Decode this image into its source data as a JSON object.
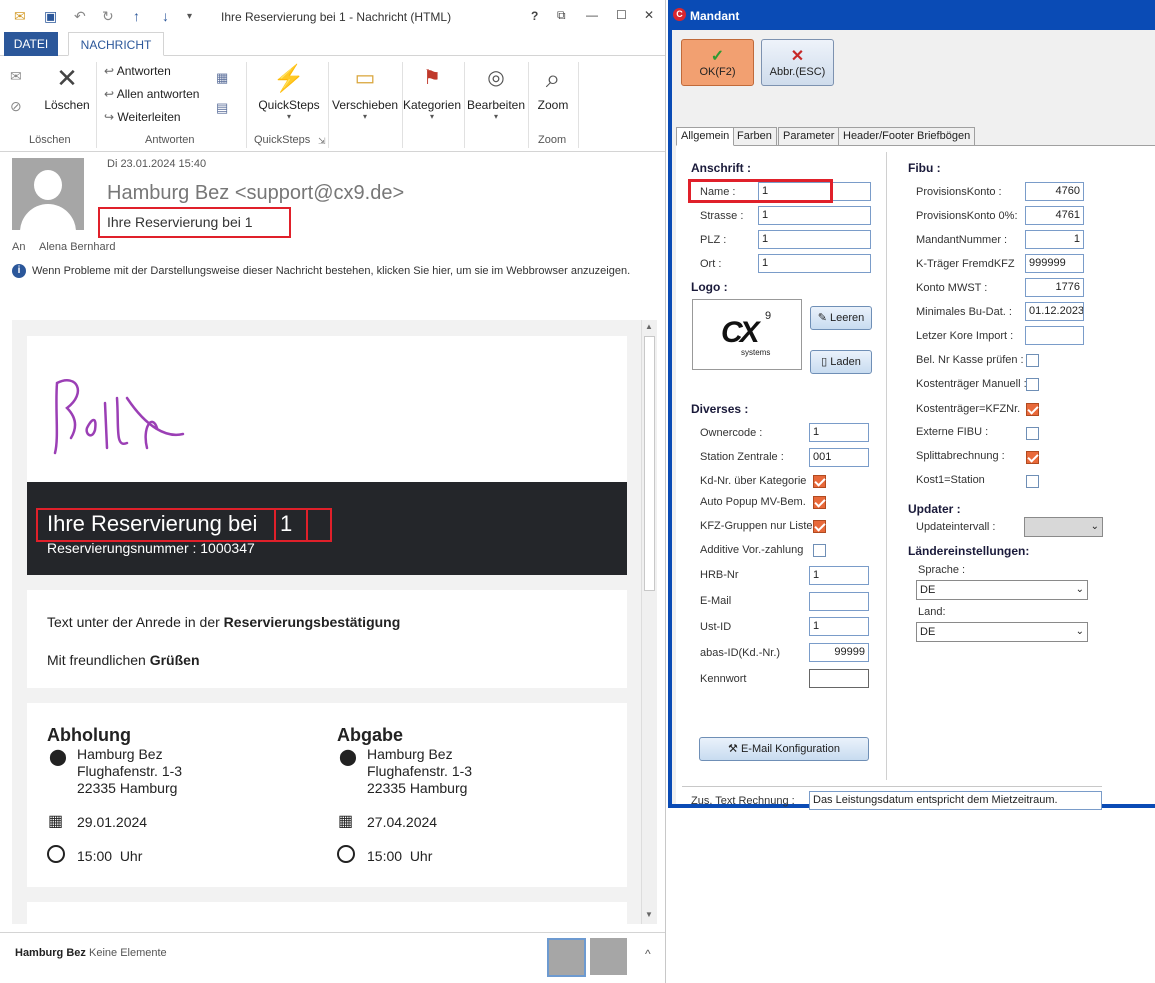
{
  "outlook": {
    "window_title": "Ihre Reservierung bei 1 - Nachricht (HTML)",
    "title_controls": {
      "help": "?",
      "restore": "⧉",
      "minimize": "—",
      "maximize": "☐",
      "close": "✕"
    },
    "tabs": [
      "DATEI",
      "NACHRICHT"
    ],
    "ribbon": {
      "loeschen_group": "Löschen",
      "loeschen_btn": "Löschen",
      "antworten_group": "Antworten",
      "antworten": "Antworten",
      "allen_antworten": "Allen antworten",
      "weiterleiten": "Weiterleiten",
      "quicksteps_group": "QuickSteps",
      "quicksteps_btn": "QuickSteps",
      "verschieben": "Verschieben",
      "kategorien": "Kategorien",
      "bearbeiten": "Bearbeiten",
      "zoom_group": "Zoom",
      "zoom_btn": "Zoom"
    },
    "header": {
      "date": "Di 23.01.2024 15:40",
      "from": "Hamburg Bez <support@cx9.de>",
      "subject": "Ihre Reservierung bei 1",
      "to_label": "An",
      "to": "Alena Bernhard",
      "info": "Wenn Probleme mit der Darstellungsweise dieser Nachricht bestehen, klicken Sie hier, um sie im Webbrowser anzuzeigen."
    },
    "body": {
      "headline_prefix": "Ihre Reservierung bei",
      "headline_value": "1",
      "resnum": "Reservierungsnummer : 1000347",
      "text_prefix": "Text unter der Anrede in der",
      "text_bold": "Reservierungsbestätigung",
      "greeting_prefix": "Mit freundlichen",
      "greeting_bold": "Grüßen",
      "pickup": {
        "title": "Abholung",
        "name": "Hamburg Bez",
        "street": "Flughafenstr. 1-3",
        "city": "22335 Hamburg",
        "date": "29.01.2024",
        "time": "15:00  Uhr"
      },
      "dropoff": {
        "title": "Abgabe",
        "name": "Hamburg Bez",
        "street": "Flughafenstr. 1-3",
        "city": "22335 Hamburg",
        "date": "27.04.2024",
        "time": "15:00  Uhr"
      }
    },
    "footer": {
      "sender": "Hamburg Bez",
      "status": "Keine Elemente"
    }
  },
  "mandant": {
    "title": "Mandant",
    "ok": "OK(F2)",
    "cancel": "Abbr.(ESC)",
    "tabs": [
      "Allgemein",
      "Farben",
      "Parameter",
      "Header/Footer Briefbögen"
    ],
    "anschrift": {
      "section": "Anschrift :",
      "name_label": "Name :",
      "name": "1",
      "strasse_label": "Strasse :",
      "strasse": "1",
      "plz_label": "PLZ :",
      "plz": "1",
      "ort_label": "Ort :",
      "ort": "1"
    },
    "logo": {
      "section": "Logo :",
      "leeren": "Leeren",
      "laden": "Laden",
      "logo_text": "systems",
      "logo_sup": "9"
    },
    "diverses": {
      "section": "Diverses :",
      "ownercode_label": "Ownercode :",
      "ownercode": "1",
      "station_label": "Station Zentrale :",
      "station": "001",
      "kdnr_label": "Kd-Nr. über Kategorie",
      "popup_label": "Auto Popup MV-Bem.",
      "kfz_label": "KFZ-Gruppen nur Liste",
      "additive_label": "Additive Vor.-zahlung",
      "hrb_label": "HRB-Nr",
      "hrb": "1",
      "email_label": "E-Mail",
      "email": "",
      "ustid_label": "Ust-ID",
      "ustid": "1",
      "abas_label": "abas-ID(Kd.-Nr.)",
      "abas": "99999",
      "kennwort_label": "Kennwort",
      "kennwort": "",
      "email_config": "E-Mail Konfiguration"
    },
    "fibu": {
      "section": "Fibu :",
      "provision_label": "ProvisionsKonto :",
      "provision": "4760",
      "provision0_label": "ProvisionsKonto 0%:",
      "provision0": "4761",
      "mandnr_label": "MandantNummer :",
      "mandnr": "1",
      "ktraeger_label": "K-Träger FremdKFZ",
      "ktraeger": "999999",
      "mwst_label": "Konto MWST :",
      "mwst": "1776",
      "budat_label": "Minimales Bu-Dat. :",
      "budat": "01.12.2023",
      "kore_label": "Letzer Kore Import :",
      "kore": "",
      "belnr_label": "Bel. Nr Kasse prüfen :",
      "ktman_label": "Kostenträger Manuell :",
      "ktkfz_label": "Kostenträger=KFZNr.",
      "extfibu_label": "Externe FIBU :",
      "split_label": "Splittabrechnung :",
      "kost1_label": "Kost1=Station"
    },
    "updater": {
      "section": "Updater :",
      "interval_label": "Updateintervall :",
      "interval": ""
    },
    "laender": {
      "section": "Ländereinstellungen:",
      "sprache_label": "Sprache :",
      "sprache": "DE",
      "land_label": "Land:",
      "land": "DE"
    },
    "zus_label": "Zus. Text Rechnung :",
    "zus_text": "Das Leistungsdatum entspricht dem Mietzeitraum."
  }
}
